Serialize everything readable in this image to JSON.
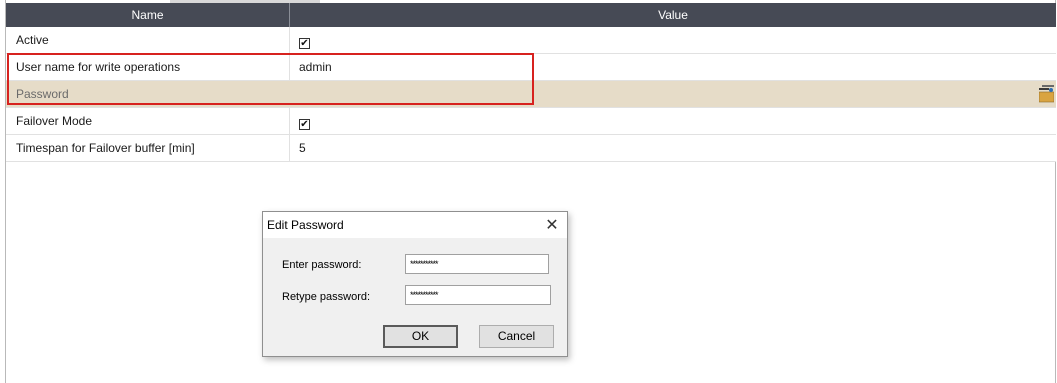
{
  "grid": {
    "header": {
      "name": "Name",
      "value": "Value"
    },
    "rows": [
      {
        "name": "Active",
        "value": "",
        "checked": true
      },
      {
        "name": "User name for write operations",
        "value": "admin"
      },
      {
        "name": "Password",
        "value": "",
        "selected": true
      },
      {
        "name": "Failover Mode",
        "value": "",
        "checked": true
      },
      {
        "name": "Timespan for Failover buffer [min]",
        "value": "5"
      }
    ],
    "check_mark": "✔",
    "edit_icon": "edit-ellipsis-icon"
  },
  "dialog": {
    "title": "Edit Password",
    "close_glyph": "✕",
    "enter_label": "Enter password:",
    "enter_value": "***********",
    "retype_label": "Retype password:",
    "retype_value": "***********",
    "ok_label": "OK",
    "cancel_label": "Cancel"
  },
  "colors": {
    "header_bg": "#464a55",
    "selected_row_bg": "#e6dcc8",
    "highlight_border": "#d7221f"
  }
}
